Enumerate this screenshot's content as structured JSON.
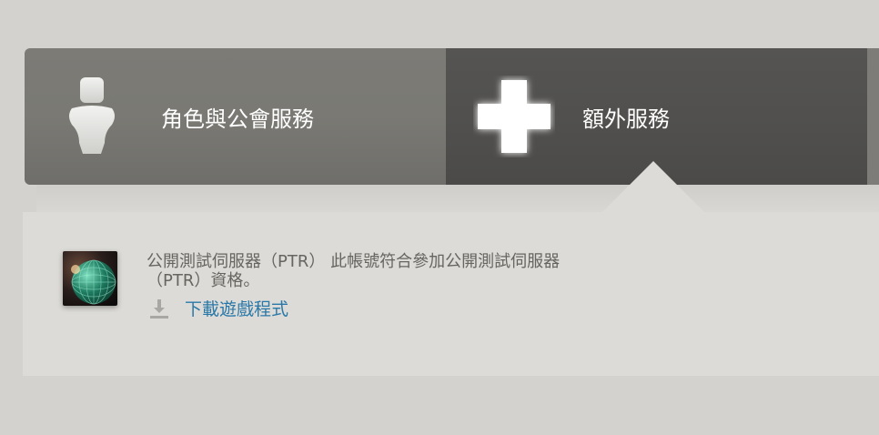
{
  "tabs": [
    {
      "label": "角色與公會服務",
      "icon": "person-icon",
      "active": false
    },
    {
      "label": "額外服務",
      "icon": "plus-icon",
      "active": true
    }
  ],
  "ptr": {
    "description": "公開測試伺服器（PTR） 此帳號符合參加公開測試伺服器（PTR）資格。",
    "download_label": "下載遊戲程式",
    "download_icon": "download-icon",
    "game_icon": "globe-game-icon"
  },
  "colors": {
    "link": "#2a78a8",
    "panel": "#dcdbd7",
    "active_tab": "#51504e",
    "inactive_tab": "#7a7974"
  }
}
